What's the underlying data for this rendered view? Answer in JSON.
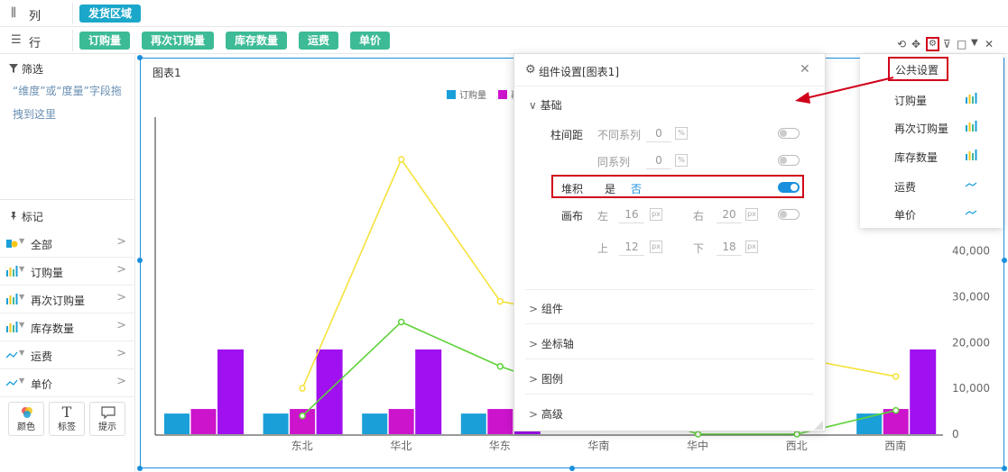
{
  "fields": {
    "columns": {
      "label": "列",
      "pills": [
        "发货区域"
      ]
    },
    "rows": {
      "label": "行",
      "pills": [
        "订购量",
        "再次订购量",
        "库存数量",
        "运费",
        "单价"
      ]
    }
  },
  "filter": {
    "title": "筛选",
    "hint": "“维度”或“度量”字段拖拽到这里"
  },
  "marks": {
    "title": "标记",
    "items": [
      "全部",
      "订购量",
      "再次订购量",
      "库存数量",
      "运费",
      "单价"
    ],
    "tools": [
      "颜色",
      "标签",
      "提示"
    ]
  },
  "chart": {
    "title": "图表1"
  },
  "dialog": {
    "title": "组件设置[图表1]",
    "basic": "基础",
    "bar_spacing_label": "柱间距",
    "diff_series_label": "不同系列",
    "diff_series_value": "0",
    "same_series_label": "同系列",
    "same_series_value": "0",
    "stack_label": "堆积",
    "stack_yes": "是",
    "stack_no": "否",
    "canvas_label": "画布",
    "left_label": "左",
    "left_value": "16",
    "right_label": "右",
    "right_value": "20",
    "top_label": "上",
    "top_value": "12",
    "bottom_label": "下",
    "bottom_value": "18",
    "sections": [
      "组件",
      "坐标轴",
      "图例",
      "高级"
    ]
  },
  "dropdown": {
    "header": "公共设置",
    "items": [
      "订购量",
      "再次订购量",
      "库存数量",
      "运费",
      "单价"
    ]
  },
  "colors": {
    "blue_pill": "#1ba7c9",
    "green_pill": "#3dbb96",
    "bar_blue": "#1a9fd8",
    "bar_magenta": "#cc14cc",
    "bar_purple": "#a010f0",
    "line_yellow": "#f5e23a",
    "line_green": "#5fd23a",
    "highlight": "#d0021b",
    "accent": "#1a8fdd"
  },
  "chart_data": {
    "type": "bar",
    "categories": [
      "",
      "东北",
      "华北",
      "华东",
      "华南",
      "华中",
      "西北",
      "西南"
    ],
    "legend": [
      "订购量",
      "再"
    ],
    "series": [
      {
        "name": "订购量",
        "values": [
          4500,
          4500,
          4500,
          4500,
          null,
          null,
          null,
          4500
        ]
      },
      {
        "values": [
          5500,
          5500,
          5500,
          5500,
          null,
          null,
          null,
          5500
        ]
      },
      {
        "values": [
          18500,
          18500,
          18500,
          18500,
          null,
          null,
          null,
          18500
        ]
      },
      {
        "values": [
          null,
          10000,
          60000,
          29000,
          null,
          null,
          null,
          12600
        ]
      },
      {
        "values": [
          null,
          4000,
          24500,
          14800,
          null,
          0,
          0,
          5200
        ]
      }
    ],
    "y_ticks": [
      0,
      10000,
      20000,
      30000,
      40000
    ],
    "y_tick_labels": [
      "0",
      "10,000",
      "20,000",
      "30,000",
      "40,000"
    ]
  }
}
